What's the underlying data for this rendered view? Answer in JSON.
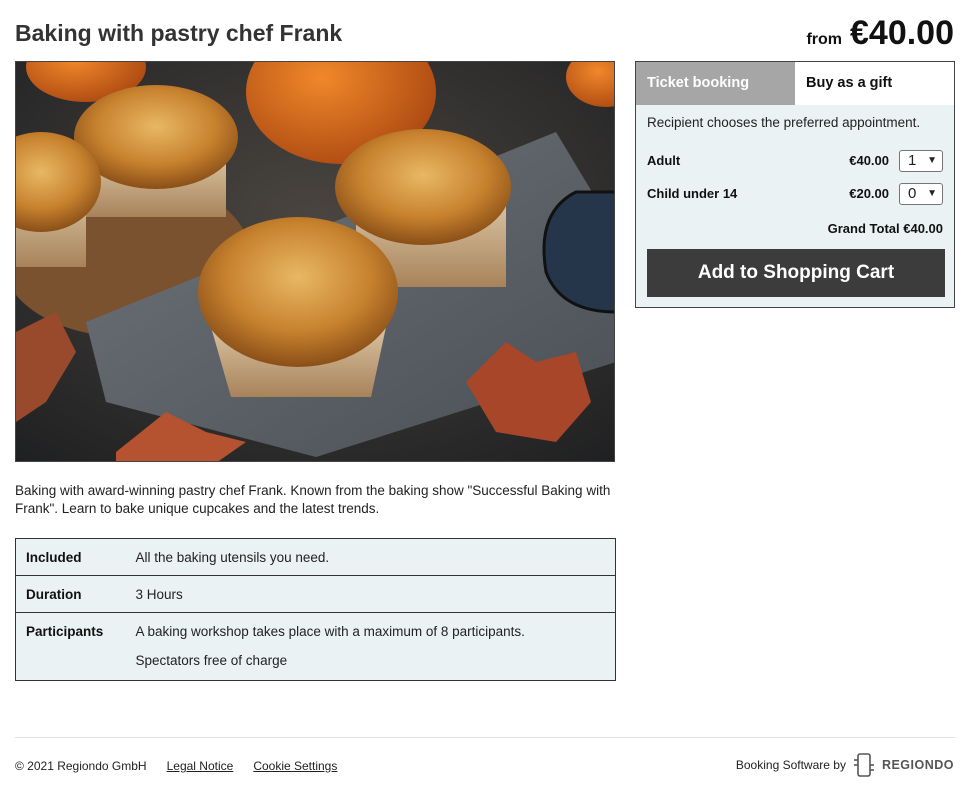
{
  "header": {
    "title": "Baking with pastry chef Frank",
    "price_prefix": "from",
    "price": "€40.00"
  },
  "hero": {
    "description": "Photo of autumn pumpkin muffins on a cloth napkin with pumpkins and leaves"
  },
  "description": "Baking with award-winning pastry chef Frank. Known from the baking show \"Successful Baking with Frank\". Learn to bake unique cupcakes and the latest trends.",
  "details": [
    {
      "label": "Included",
      "value": "All the baking utensils you need."
    },
    {
      "label": "Duration",
      "value": "3 Hours"
    },
    {
      "label": "Participants",
      "value": "A baking workshop takes place with a maximum of 8 participants.",
      "value2": "Spectators free of charge"
    }
  ],
  "booking": {
    "tabs": [
      "Ticket booking",
      "Buy as a gift"
    ],
    "recipient_note": "Recipient chooses the preferred appointment.",
    "tickets": [
      {
        "name": "Adult",
        "price": "€40.00",
        "qty": "1"
      },
      {
        "name": "Child under 14",
        "price": "€20.00",
        "qty": "0"
      }
    ],
    "grand_total": "Grand Total €40.00",
    "cart_button": "Add to Shopping Cart"
  },
  "footer": {
    "copyright": "© 2021 Regiondo GmbH",
    "links": [
      "Legal Notice",
      "Cookie Settings"
    ],
    "powered_by": "Booking Software by",
    "brand": "REGIONDO"
  }
}
